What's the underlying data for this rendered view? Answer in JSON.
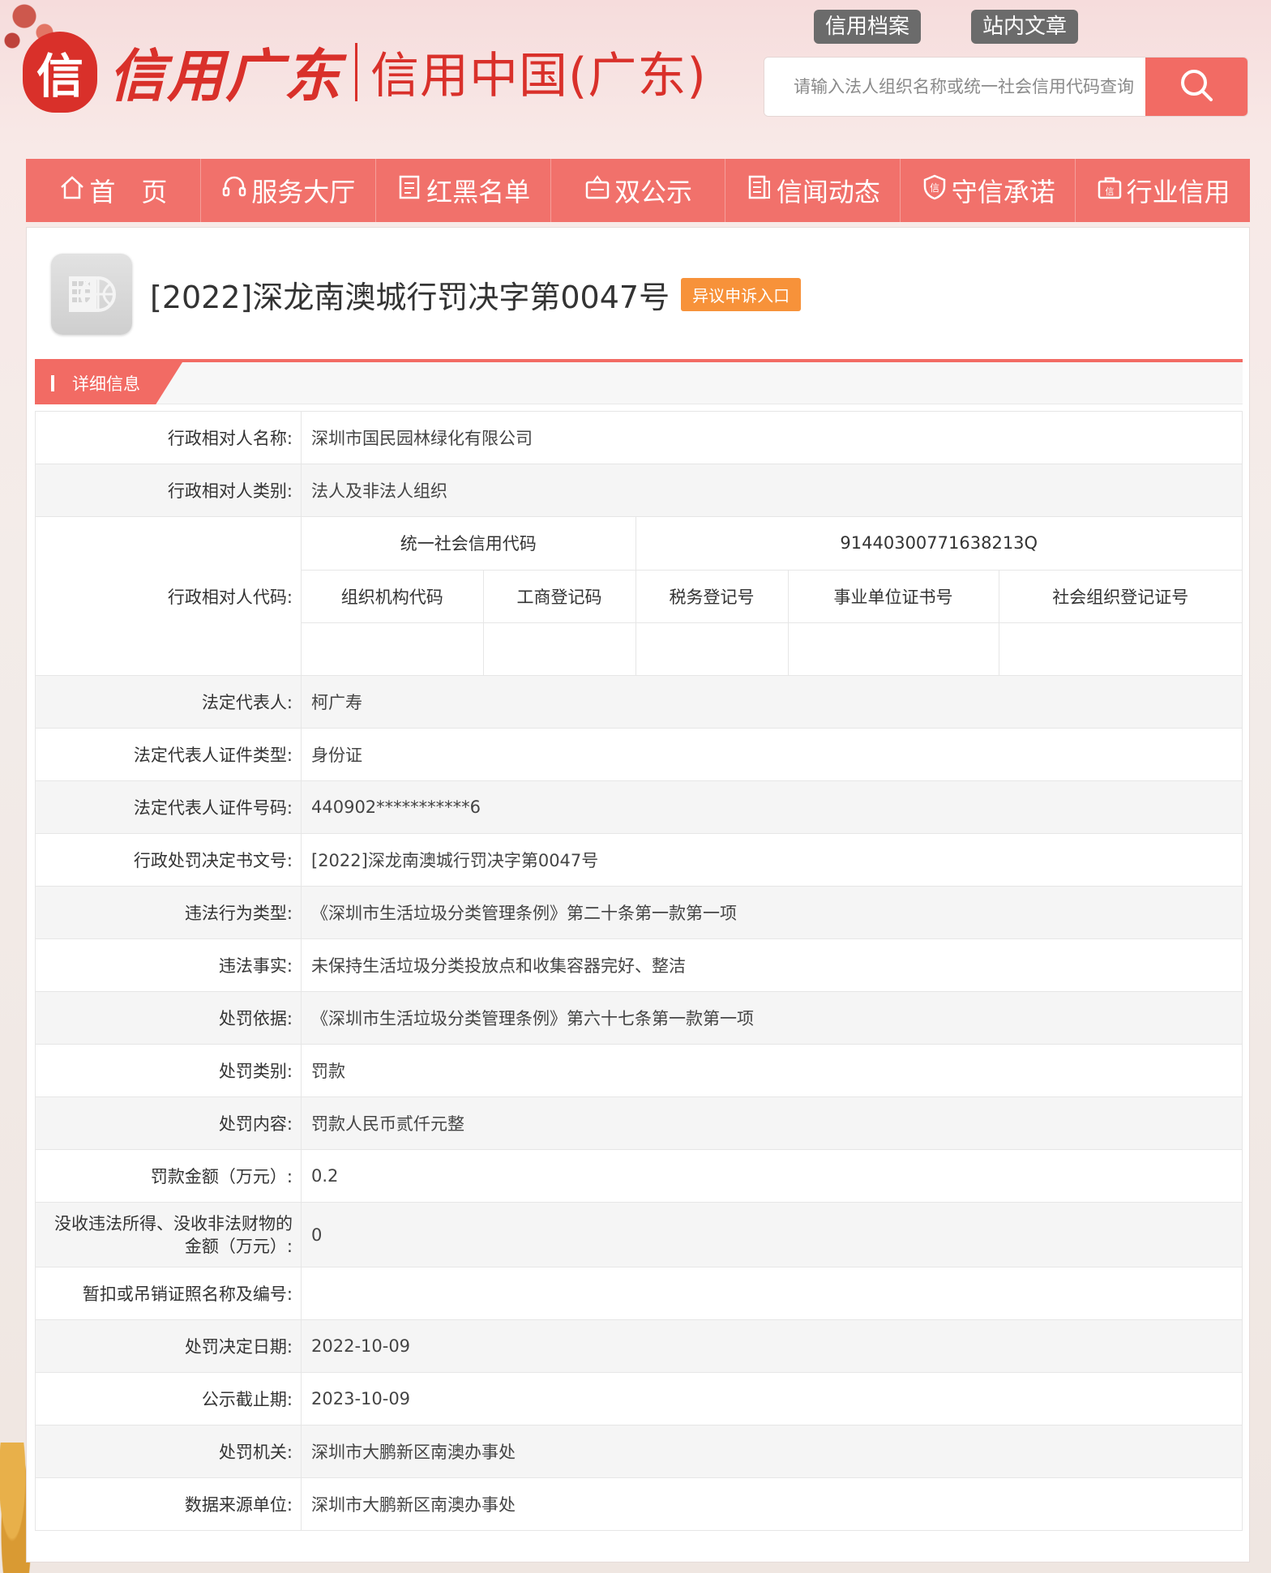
{
  "header": {
    "logo_seal": "信",
    "logo_main": "信用广东",
    "logo_sub": "信用中国(广东)",
    "top_tabs": [
      "信用档案",
      "站内文章"
    ],
    "search_placeholder": "请输入法人组织名称或统一社会信用代码查询"
  },
  "nav": {
    "items": [
      {
        "label": "首　页",
        "icon": "home-icon"
      },
      {
        "label": "服务大厅",
        "icon": "headset-icon"
      },
      {
        "label": "红黑名单",
        "icon": "list-icon"
      },
      {
        "label": "双公示",
        "icon": "bulletin-icon"
      },
      {
        "label": "信闻动态",
        "icon": "news-icon"
      },
      {
        "label": "守信承诺",
        "icon": "shield-icon"
      },
      {
        "label": "行业信用",
        "icon": "briefcase-icon"
      }
    ]
  },
  "page": {
    "title": "[2022]深龙南澳城行罚决字第0047号",
    "appeal_button": "异议申诉入口",
    "section_tab": "详细信息"
  },
  "details": {
    "rows": [
      {
        "label": "行政相对人名称:",
        "value": "深圳市国民园林绿化有限公司"
      },
      {
        "label": "行政相对人类别:",
        "value": "法人及非法人组织"
      }
    ],
    "code_label": "行政相对人代码:",
    "codes": {
      "uscc_label": "统一社会信用代码",
      "uscc_value": "91440300771638213Q",
      "columns": [
        "组织机构代码",
        "工商登记码",
        "税务登记号",
        "事业单位证书号",
        "社会组织登记证号"
      ],
      "values": [
        "",
        "",
        "",
        "",
        ""
      ]
    },
    "rows2": [
      {
        "label": "法定代表人:",
        "value": "柯广寿"
      },
      {
        "label": "法定代表人证件类型:",
        "value": "身份证"
      },
      {
        "label": "法定代表人证件号码:",
        "value": "440902***********6"
      },
      {
        "label": "行政处罚决定书文号:",
        "value": "[2022]深龙南澳城行罚决字第0047号"
      },
      {
        "label": "违法行为类型:",
        "value": "《深圳市生活垃圾分类管理条例》第二十条第一款第一项"
      },
      {
        "label": "违法事实:",
        "value": "未保持生活垃圾分类投放点和收集容器完好、整洁"
      },
      {
        "label": "处罚依据:",
        "value": "《深圳市生活垃圾分类管理条例》第六十七条第一款第一项"
      },
      {
        "label": "处罚类别:",
        "value": "罚款"
      },
      {
        "label": "处罚内容:",
        "value": "罚款人民币贰仟元整"
      },
      {
        "label": "罚款金额（万元）:",
        "value": "0.2"
      }
    ],
    "confiscation_label_1": "没收违法所得、没收非法财物的",
    "confiscation_label_2": "金额（万元）:",
    "confiscation_value": "0",
    "rows3": [
      {
        "label": "暂扣或吊销证照名称及编号:",
        "value": ""
      },
      {
        "label": "处罚决定日期:",
        "value": "2022-10-09"
      },
      {
        "label": "公示截止期:",
        "value": "2023-10-09"
      },
      {
        "label": "处罚机关:",
        "value": "深圳市大鹏新区南澳办事处"
      },
      {
        "label": "数据来源单位:",
        "value": "深圳市大鹏新区南澳办事处"
      }
    ]
  },
  "colors": {
    "brand_red": "#d9302a",
    "nav_red": "#f1716b",
    "search_red": "#f26b64",
    "appeal_orange": "#f7923a"
  }
}
